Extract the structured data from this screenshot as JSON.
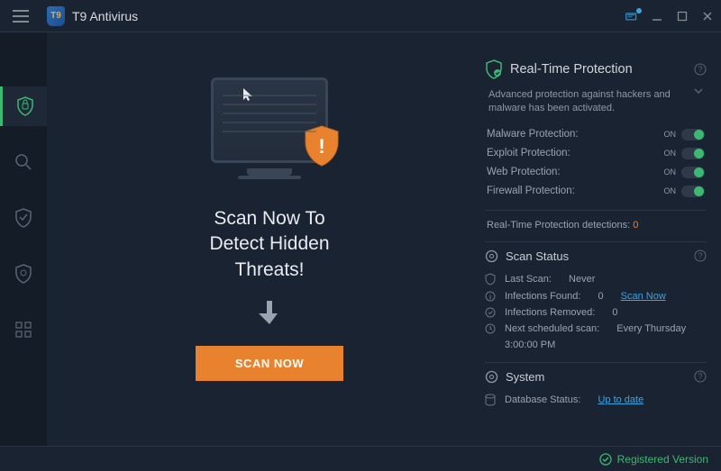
{
  "app": {
    "title": "T9 Antivirus",
    "logo_text": "T9"
  },
  "hero": {
    "headline_l1": "Scan Now To",
    "headline_l2": "Detect Hidden",
    "headline_l3": "Threats!",
    "scan_button": "SCAN NOW"
  },
  "realtime": {
    "title": "Real-Time Protection",
    "subtext": "Advanced protection against hackers and malware has been activated.",
    "items": [
      {
        "label": "Malware Protection:",
        "state": "ON"
      },
      {
        "label": "Exploit Protection:",
        "state": "ON"
      },
      {
        "label": "Web Protection:",
        "state": "ON"
      },
      {
        "label": "Firewall Protection:",
        "state": "ON"
      }
    ],
    "detections_label": "Real-Time Protection detections:",
    "detections_count": "0"
  },
  "scan_status": {
    "title": "Scan Status",
    "last_scan_label": "Last Scan:",
    "last_scan_value": "Never",
    "infections_found_label": "Infections Found:",
    "infections_found_value": "0",
    "scan_now_link": "Scan Now",
    "infections_removed_label": "Infections Removed:",
    "infections_removed_value": "0",
    "next_scan_label": "Next scheduled scan:",
    "next_scan_value": "Every Thursday",
    "next_scan_time": "3:00:00 PM"
  },
  "system": {
    "title": "System",
    "db_label": "Database Status:",
    "db_value": "Up to date"
  },
  "footer": {
    "registered": "Registered Version"
  }
}
